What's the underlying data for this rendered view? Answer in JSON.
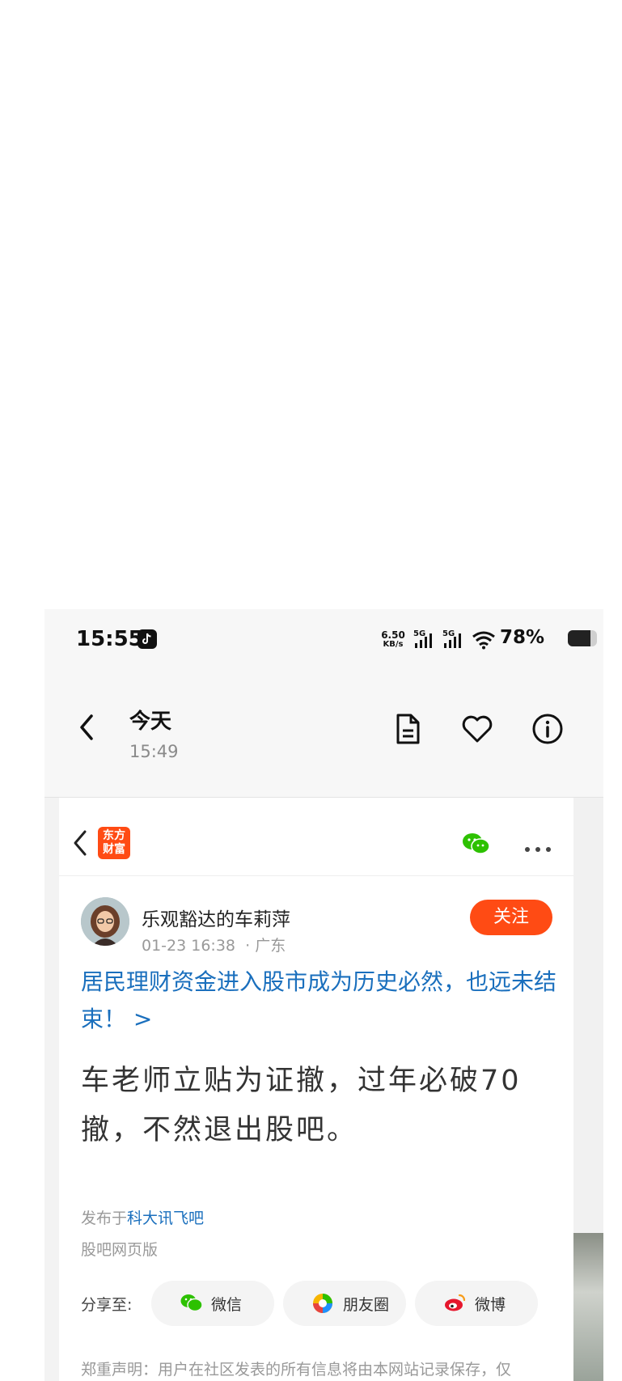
{
  "status_bar": {
    "time": "15:55",
    "net_speed_value": "6.50",
    "net_speed_unit": "KB/s",
    "network1": "5G",
    "network2": "5G",
    "battery_percent": "78%",
    "battery_level": 0.78
  },
  "nav": {
    "title": "今天",
    "subtitle": "15:49"
  },
  "web_header": {
    "logo_line1": "东方",
    "logo_line2": "财富"
  },
  "author": {
    "name": "乐观豁达的车莉萍",
    "date": "01-23 16:38",
    "location": "· 广东",
    "follow_label": "关注"
  },
  "post": {
    "headline": "居民理财资金进入股市成为历史必然，也远未结束！ >",
    "body": "车老师立贴为证撤，过年必破70撤，不然退出股吧。",
    "published_prefix": "发布于",
    "published_bar": "科大讯飞吧",
    "source": "股吧网页版"
  },
  "share": {
    "label": "分享至:",
    "wechat": "微信",
    "moments": "朋友圈",
    "weibo": "微博"
  },
  "disclaimer": "郑重声明：用户在社区发表的所有信息将由本网站记录保存，仅",
  "colors": {
    "brand_orange": "#ff4b14",
    "link_blue": "#1a6fbd",
    "wechat_green": "#2dc100"
  }
}
